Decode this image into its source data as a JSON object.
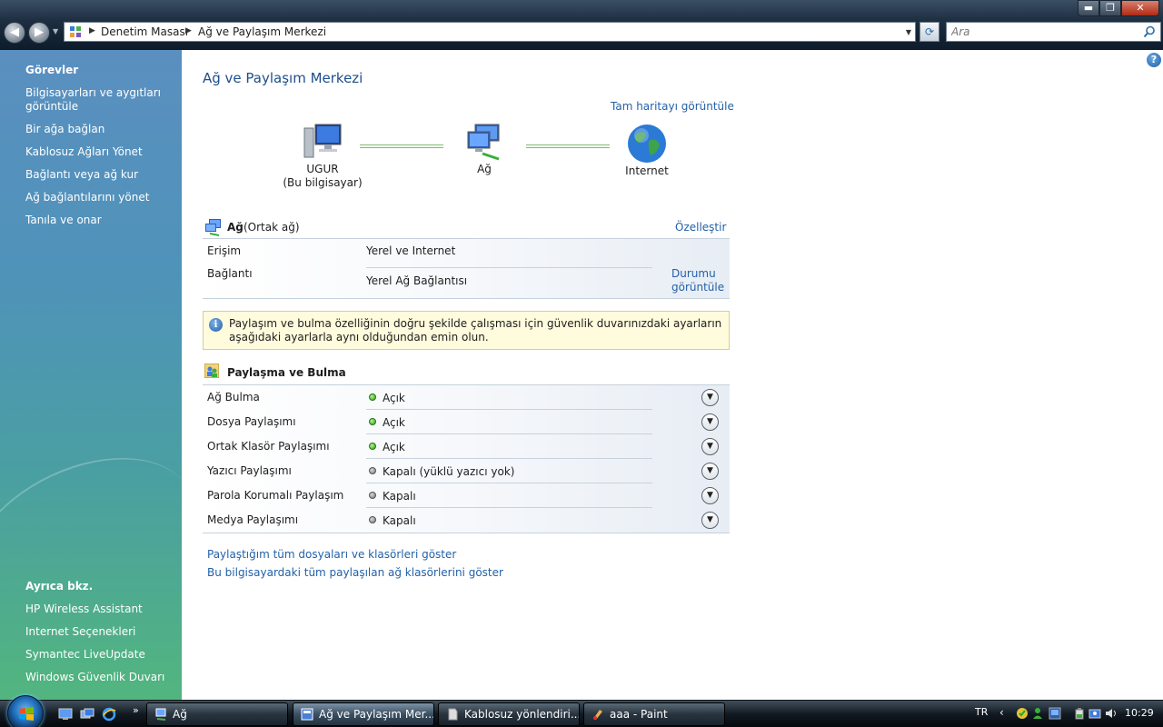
{
  "address_bar": {
    "breadcrumbs": [
      "Denetim Masası",
      "Ağ ve Paylaşım Merkezi"
    ],
    "search_placeholder": "Ara"
  },
  "window_controls": {
    "minimize": "▬",
    "maximize": "❐",
    "close": "✕"
  },
  "sidebar": {
    "tasks_heading": "Görevler",
    "tasks": [
      "Bilgisayarları ve aygıtları görüntüle",
      "Bir ağa bağlan",
      "Kablosuz Ağları Yönet",
      "Bağlantı veya ağ kur",
      "Ağ bağlantılarını yönet",
      "Tanıla ve onar"
    ],
    "see_also_heading": "Ayrıca bkz.",
    "see_also": [
      "HP Wireless Assistant",
      "Internet Seçenekleri",
      "Symantec LiveUpdate",
      "Windows Güvenlik Duvarı"
    ]
  },
  "main": {
    "title": "Ağ ve Paylaşım Merkezi",
    "full_map_link": "Tam haritayı görüntüle",
    "network_map": {
      "computer_name": "UGUR",
      "computer_sub": "(Bu bilgisayar)",
      "network_name": "Ağ",
      "internet_name": "Internet"
    },
    "network": {
      "name": "Ağ",
      "type": "(Ortak ağ)",
      "customize_link": "Özelleştir",
      "access_label": "Erişim",
      "access_value": "Yerel ve Internet",
      "connection_label": "Bağlantı",
      "connection_value": "Yerel Ağ Bağlantısı",
      "view_status_link": "Durumu görüntüle"
    },
    "info_message": "Paylaşım ve bulma özelliğinin doğru şekilde çalışması için güvenlik duvarınızdaki ayarların aşağıdaki ayarlarla aynı olduğundan emin olun.",
    "sharing": {
      "heading": "Paylaşma ve Bulma",
      "rows": [
        {
          "label": "Ağ Bulma",
          "value": "Açık",
          "status": "on"
        },
        {
          "label": "Dosya Paylaşımı",
          "value": "Açık",
          "status": "on"
        },
        {
          "label": "Ortak Klasör Paylaşımı",
          "value": "Açık",
          "status": "on"
        },
        {
          "label": "Yazıcı Paylaşımı",
          "value": "Kapalı (yüklü yazıcı yok)",
          "status": "off"
        },
        {
          "label": "Parola Korumalı Paylaşım",
          "value": "Kapalı",
          "status": "off"
        },
        {
          "label": "Medya Paylaşımı",
          "value": "Kapalı",
          "status": "off"
        }
      ]
    },
    "links": [
      "Paylaştığım tüm dosyaları ve klasörleri göster",
      "Bu bilgisayardaki tüm paylaşılan ağ klasörlerini göster"
    ]
  },
  "taskbar": {
    "tasks": [
      {
        "label": "Ağ",
        "active": false
      },
      {
        "label": "Ağ ve Paylaşım Mer...",
        "active": true
      },
      {
        "label": "Kablosuz yönlendiri...",
        "active": false
      },
      {
        "label": "aaa - Paint",
        "active": false
      }
    ],
    "language": "TR",
    "clock": "10:29"
  }
}
